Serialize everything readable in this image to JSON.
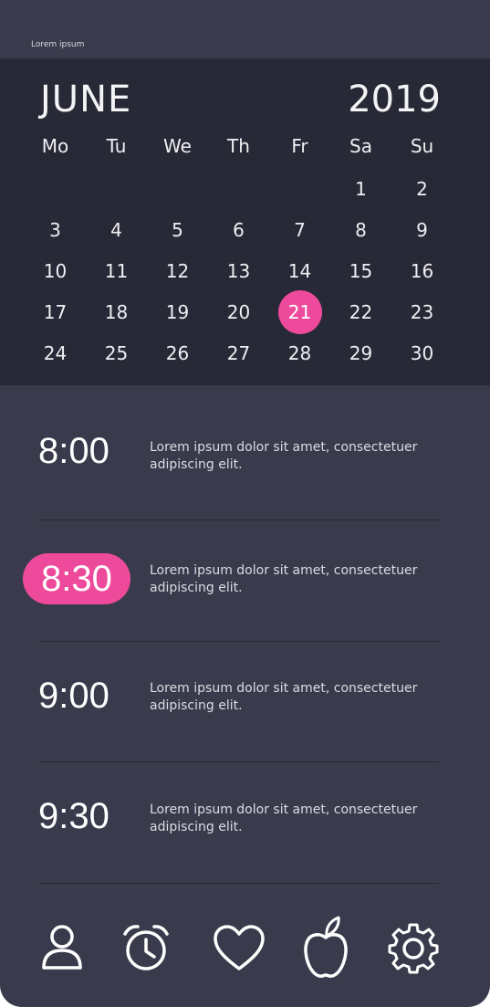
{
  "status_bar": {
    "text": "Lorem ipsum"
  },
  "calendar": {
    "month": "JUNE",
    "year": "2019",
    "weekdays": [
      "Mo",
      "Tu",
      "We",
      "Th",
      "Fr",
      "Sa",
      "Su"
    ],
    "weeks": [
      [
        "",
        "",
        "",
        "",
        "",
        "1",
        "2"
      ],
      [
        "3",
        "4",
        "5",
        "6",
        "7",
        "8",
        "9"
      ],
      [
        "10",
        "11",
        "12",
        "13",
        "14",
        "15",
        "16"
      ],
      [
        "17",
        "18",
        "19",
        "20",
        "21",
        "22",
        "23"
      ],
      [
        "24",
        "25",
        "26",
        "27",
        "28",
        "29",
        "30"
      ]
    ],
    "selected_day": "21",
    "accent_color": "#ee4a9b"
  },
  "schedule": {
    "slots": [
      {
        "time": "8:00",
        "text": "Lorem ipsum dolor sit amet, consectetuer adipiscing elit.",
        "active": false
      },
      {
        "time": "8:30",
        "text": "Lorem ipsum dolor sit amet, consectetuer adipiscing elit.",
        "active": true
      },
      {
        "time": "9:00",
        "text": "Lorem ipsum dolor sit amet, consectetuer adipiscing elit.",
        "active": false
      },
      {
        "time": "9:30",
        "text": "Lorem ipsum dolor sit amet, consectetuer adipiscing elit.",
        "active": false
      }
    ]
  },
  "nav": {
    "items": [
      {
        "icon": "person-icon",
        "active": false
      },
      {
        "icon": "alarm-clock-icon",
        "active": true
      },
      {
        "icon": "heart-icon",
        "active": false
      },
      {
        "icon": "apple-icon",
        "active": false
      },
      {
        "icon": "gear-icon",
        "active": false
      }
    ]
  }
}
